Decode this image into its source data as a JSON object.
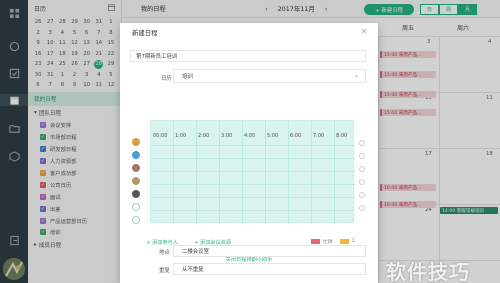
{
  "sidebar": {
    "header_label": "日历",
    "mini_calendar": [
      [
        "26",
        "27",
        "28",
        "29",
        "30",
        "31",
        "1"
      ],
      [
        "2",
        "3",
        "4",
        "5",
        "6",
        "7",
        "8"
      ],
      [
        "9",
        "10",
        "11",
        "12",
        "13",
        "14",
        "15"
      ],
      [
        "16",
        "17",
        "18",
        "19",
        "20",
        "21",
        "22"
      ],
      [
        "23",
        "24",
        "25",
        "26",
        "27",
        "28",
        "29"
      ],
      [
        "30",
        "31",
        "1",
        "2",
        "3",
        "4",
        "5"
      ],
      [
        "6",
        "7",
        "8",
        "9",
        "10",
        "11",
        "12"
      ]
    ],
    "today": "28",
    "my_calendar_label": "我的日程",
    "team_calendar_label": "团队日程",
    "team_items": [
      {
        "label": "会议安排",
        "color": "#a974d6"
      },
      {
        "label": "市场部日程",
        "color": "#3fa86b"
      },
      {
        "label": "研发部日程",
        "color": "#3f7fc8"
      },
      {
        "label": "人力资源部",
        "color": "#8f6bd0"
      },
      {
        "label": "客户成功部",
        "color": "#f0a640"
      },
      {
        "label": "公司日历",
        "color": "#e05c6b"
      },
      {
        "label": "面试",
        "color": "#c16cc2"
      },
      {
        "label": "出差",
        "color": "#6b74d6"
      },
      {
        "label": "产品运营部日历",
        "color": "#a974d6"
      },
      {
        "label": "培训",
        "color": "#3fa86b"
      }
    ],
    "member_calendar_label": "成员日程"
  },
  "topbar": {
    "title": "我的日程",
    "month": "2017年11月",
    "prev": "‹",
    "next": "›",
    "new_button": "+ 新建日程",
    "views": [
      "日",
      "周",
      "月"
    ],
    "selected_view": "月"
  },
  "calendar": {
    "columns": [
      "周五",
      "周六"
    ],
    "day_numbers": [
      "3",
      "4",
      "10",
      "11",
      "17",
      "18",
      "24",
      "25"
    ],
    "events": [
      "15:00 来周产品...",
      "15:00 来周产品...",
      "15:00 来周产品...",
      "15:00 来周产品...",
      "16:00 来周产品...",
      "16:00 来周产品...",
      "14:00 客服常规培训"
    ]
  },
  "modal": {
    "header": "新建日程",
    "close": "×",
    "title_value": "第7期新员工培训",
    "calendar_label": "日历",
    "calendar_value": "培训",
    "times": [
      "00:00",
      "1:00",
      "2:00",
      "3:00",
      "4:00",
      "5:00",
      "6:00",
      "7:00",
      "8:00"
    ],
    "add_participant": "+ 添加参与人",
    "add_room": "+ 添加会议资源",
    "legend_busy": "忙碌",
    "legend_other": "1",
    "close_helper": "关闭日程排期小助手",
    "location_label": "地点",
    "location_value": "二楼会议室",
    "repeat_label": "重复",
    "repeat_value": "从不重复"
  },
  "colors": {
    "accent": "#26b47f",
    "rail": "#2f3d45",
    "schedule_bg": "#d9f3ee",
    "busy_red": "#e5677a",
    "legend_orange": "#f0b840"
  },
  "watermark": "软件技巧"
}
